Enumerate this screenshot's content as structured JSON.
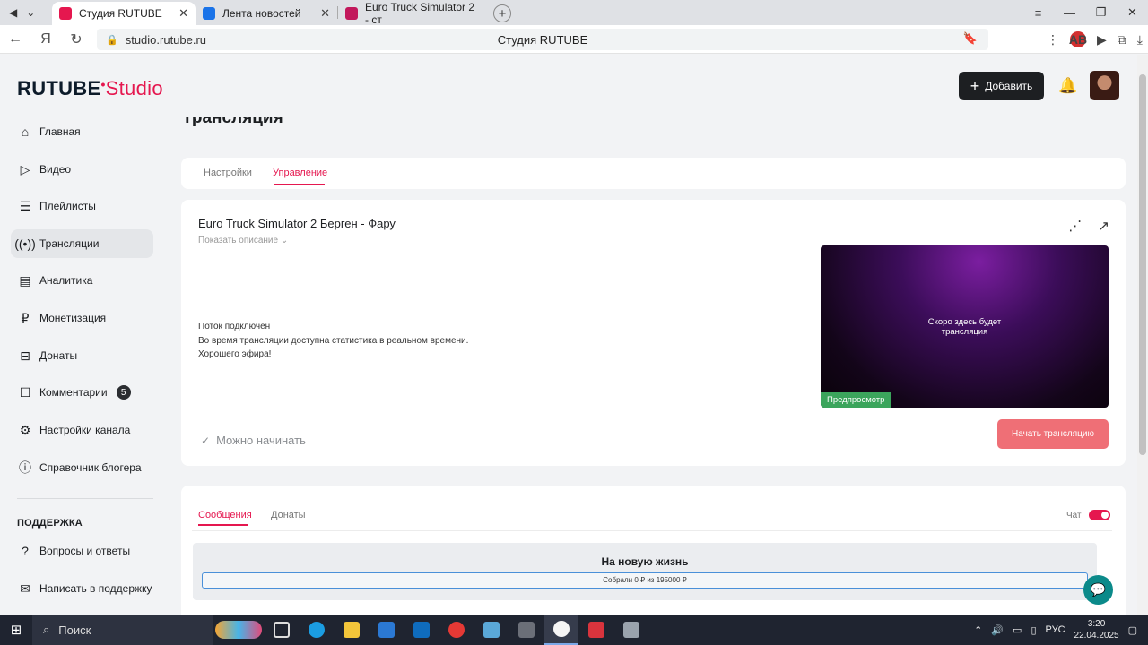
{
  "browser": {
    "tabs": [
      {
        "title": "Студия RUTUBE",
        "active": true,
        "color": "#e5174f"
      },
      {
        "title": "Лента новостей",
        "active": false,
        "color": "#1a73e8"
      },
      {
        "title": "Euro Truck Simulator 2 - ст",
        "active": false,
        "color": "#c2185b"
      }
    ],
    "url": "studio.rutube.ru",
    "page_title": "Студия RUTUBE"
  },
  "header": {
    "logo_main": "RUTUBE",
    "logo_sub": "Studio",
    "add_label": "Добавить"
  },
  "sidebar": {
    "items": [
      {
        "label": "Главная",
        "icon": "home-icon"
      },
      {
        "label": "Видео",
        "icon": "video-icon"
      },
      {
        "label": "Плейлисты",
        "icon": "playlist-icon"
      },
      {
        "label": "Трансляции",
        "icon": "broadcast-icon",
        "active": true
      },
      {
        "label": "Аналитика",
        "icon": "analytics-icon"
      },
      {
        "label": "Монетизация",
        "icon": "money-icon"
      },
      {
        "label": "Донаты",
        "icon": "donate-icon"
      },
      {
        "label": "Комментарии",
        "icon": "comments-icon",
        "badge": "5"
      },
      {
        "label": "Настройки канала",
        "icon": "gear-icon"
      },
      {
        "label": "Справочник блогера",
        "icon": "info-icon"
      }
    ],
    "support_title": "ПОДДЕРЖКА",
    "support_items": [
      {
        "label": "Вопросы и ответы",
        "icon": "faq-icon"
      },
      {
        "label": "Написать в поддержку",
        "icon": "mail-icon"
      }
    ]
  },
  "main": {
    "title": "Трансляция",
    "tabs": [
      {
        "label": "Настройки",
        "selected": false
      },
      {
        "label": "Управление",
        "selected": true
      }
    ],
    "stream": {
      "title": "Euro Truck Simulator 2 Берген - Фару",
      "show_description": "Показать описание",
      "status_title": "Поток подключён",
      "status_line1": "Во время трансляции доступна статистика в реальном времени.",
      "status_line2": "Хорошего эфира!",
      "preview_text_1": "Скоро здесь будет",
      "preview_text_2": "трансляция",
      "preview_tag": "Предпросмотр",
      "ready_label": "Можно начинать",
      "start_button": "Начать трансляцию"
    },
    "chat": {
      "tabs": [
        {
          "label": "Сообщения",
          "selected": true
        },
        {
          "label": "Донаты",
          "selected": false
        }
      ],
      "chat_toggle_label": "Чат",
      "chat_enabled": true,
      "goal_title": "На новую жизнь",
      "goal_progress": "Собрали 0 ₽  из 195000 ₽"
    }
  },
  "taskbar": {
    "search_label": "Поиск",
    "lang": "РУС",
    "time": "3:20",
    "date": "22.04.2025"
  },
  "colors": {
    "brand": "#e5174f",
    "start_button": "#ef6f76",
    "preview_tag": "#3ba55c"
  }
}
